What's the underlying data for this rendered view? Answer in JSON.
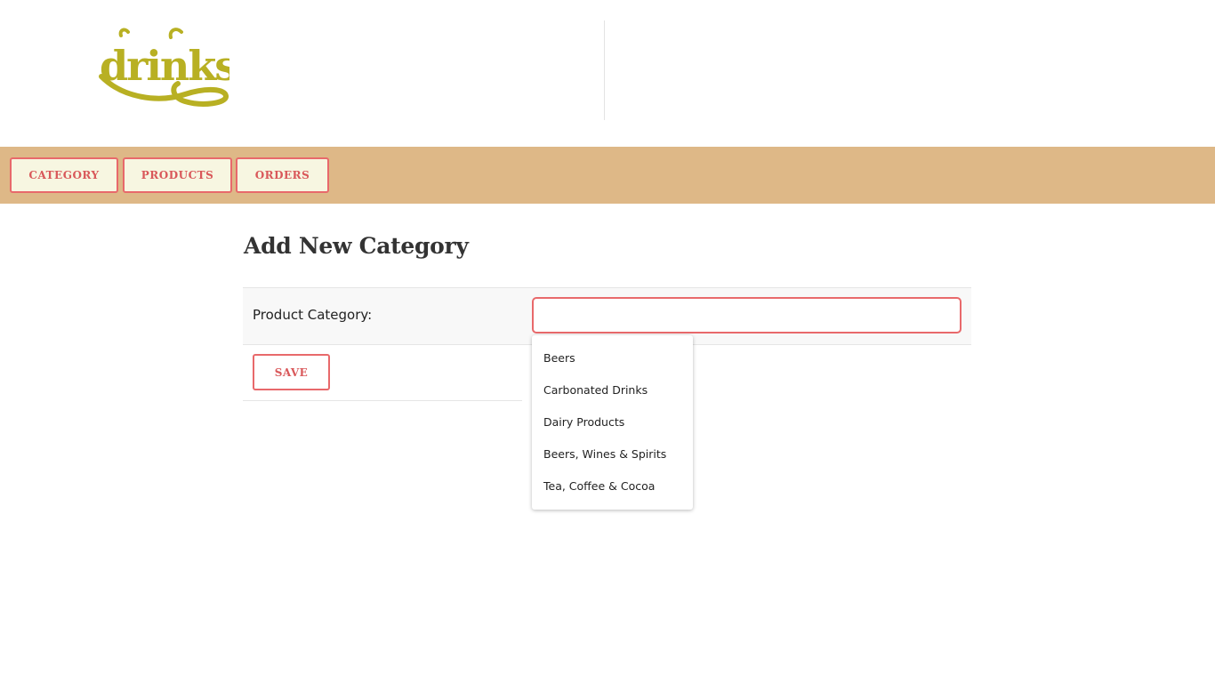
{
  "header": {
    "logo_text": "drinks"
  },
  "nav": {
    "items": [
      {
        "label": "CATEGORY"
      },
      {
        "label": "PRODUCTS"
      },
      {
        "label": "ORDERS"
      }
    ]
  },
  "main": {
    "title": "Add New Category",
    "form": {
      "product_category_label": "Product Category:",
      "product_category_value": "",
      "save_label": "SAVE"
    },
    "suggestions": [
      "Beers",
      "Carbonated Drinks",
      "Dairy Products",
      "Beers, Wines & Spirits",
      "Tea, Coffee & Cocoa"
    ]
  },
  "colors": {
    "navbar_bg": "#deb887",
    "accent": "#e8696b",
    "logo": "#b8b023",
    "button_bg": "#f7f6e1"
  }
}
